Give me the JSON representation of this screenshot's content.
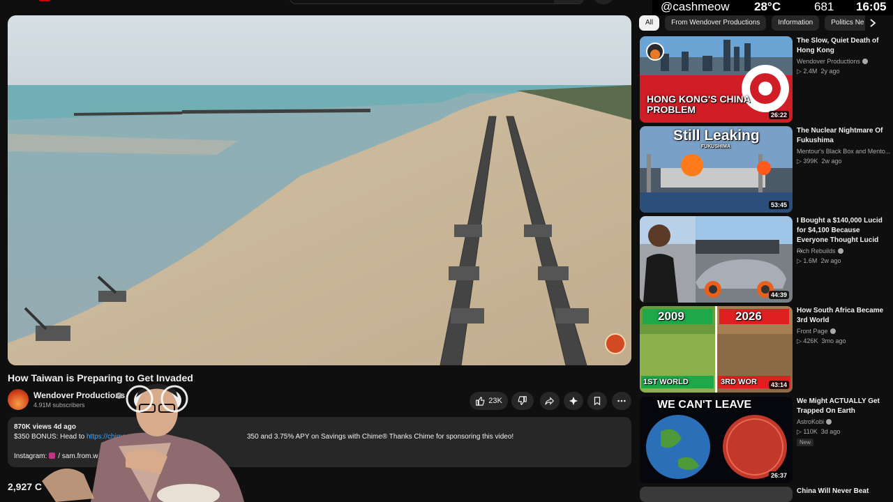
{
  "overlay": {
    "handle": "@cashmeow",
    "temperature": "28°C",
    "count": "681",
    "time": "16:05"
  },
  "video": {
    "title": "How Taiwan is Preparing to Get Invaded",
    "channel": "Wendover Productions",
    "subscribers": "4.91M subscribers",
    "likes": "23K",
    "views_date": "870K views  4d ago",
    "desc_prefix": "$350 BONUS: Head to ",
    "desc_link": "https://chime.co",
    "desc_suffix": "350 and 3.75% APY on Savings with Chime® Thanks Chime for sponsoring this video!",
    "instagram_label": "Instagram:",
    "instagram_handle": "/ sam.from.w",
    "comments": "2,927 C"
  },
  "chips": [
    "All",
    "From Wendover Productions",
    "Information",
    "Politics Ne"
  ],
  "recommendations": [
    {
      "title": "The Slow, Quiet Death of Hong Kong",
      "channel": "Wendover Productions",
      "verified": true,
      "views": "2.4M",
      "age": "2y ago",
      "duration": "26:22",
      "thumb_text": "HONG KONG'S CHINA PROBLEM"
    },
    {
      "title": "The Nuclear Nightmare Of Fukushima",
      "channel": "Mentour's Black Box and Mento...",
      "verified": false,
      "views": "399K",
      "age": "2w ago",
      "duration": "53:45",
      "thumb_text": "Still Leaking",
      "thumb_sub": "FUKUSHIMA"
    },
    {
      "title": "I Bought a $140,000 Lucid for $4,100 Because Everyone Thought Lucid ...",
      "channel": "Rich Rebuilds",
      "verified": true,
      "views": "1.6M",
      "age": "2w ago",
      "duration": "44:39"
    },
    {
      "title": "How South Africa Became 3rd World",
      "channel": "Front Page",
      "verified": true,
      "views": "426K",
      "age": "3mo ago",
      "duration": "43:14",
      "thumb_year_left": "2009",
      "thumb_year_right": "2026",
      "thumb_label_left": "1ST WORLD",
      "thumb_label_right": "3RD WOR"
    },
    {
      "title": "We Might ACTUALLY Get Trapped On Earth",
      "channel": "AstroKobi",
      "verified": true,
      "views": "110K",
      "age": "3d ago",
      "duration": "26:37",
      "badge": "New",
      "thumb_text": "WE CAN'T LEAVE"
    },
    {
      "title": "China Will Never Beat"
    }
  ],
  "colors": {
    "background": "#0f0f0f",
    "surface": "#272727",
    "link": "#3ea6ff",
    "text_secondary": "#aaaaaa"
  }
}
